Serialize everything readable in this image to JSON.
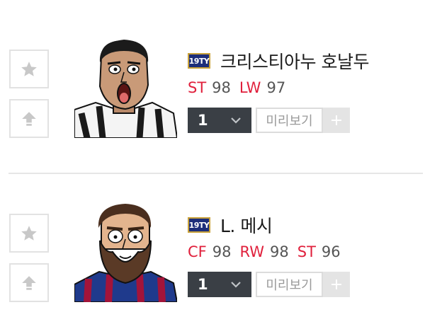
{
  "players": [
    {
      "season": "19TY",
      "name": "크리스티아누 호날두",
      "positions": [
        {
          "code": "ST",
          "rating": "98"
        },
        {
          "code": "LW",
          "rating": "97"
        }
      ],
      "level": "1",
      "preview_label": "미리보기",
      "icons": {
        "favorite": "star-icon",
        "upgrade": "arrow-up-icon",
        "level": "chevron-down-icon",
        "add": "plus-icon"
      }
    },
    {
      "season": "19TY",
      "name": "L. 메시",
      "positions": [
        {
          "code": "CF",
          "rating": "98"
        },
        {
          "code": "RW",
          "rating": "98"
        },
        {
          "code": "ST",
          "rating": "96"
        }
      ],
      "level": "1",
      "preview_label": "미리보기",
      "icons": {
        "favorite": "star-icon",
        "upgrade": "arrow-up-icon",
        "level": "chevron-down-icon",
        "add": "plus-icon"
      }
    }
  ],
  "colors": {
    "position_accent": "#e0203c",
    "level_select_bg": "#3a3f45",
    "season_badge_bg": "#1d2e7a",
    "border": "#e2e2e2"
  }
}
